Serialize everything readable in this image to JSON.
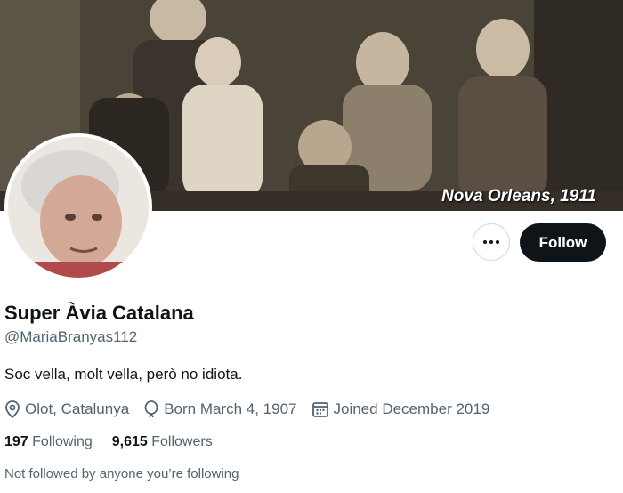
{
  "banner": {
    "caption": "Nova Orleans, 1911"
  },
  "profile": {
    "display_name": "Super Àvia Catalana",
    "handle": "@MariaBranyas112",
    "bio": "Soc vella, molt vella, però no idiota.",
    "location": "Olot, Catalunya",
    "birth": "Born March 4, 1907",
    "joined": "Joined December 2019"
  },
  "actions": {
    "more_icon": "more-horizontal-icon",
    "follow_label": "Follow"
  },
  "stats": {
    "following_count": "197",
    "following_label": "Following",
    "followers_count": "9,615",
    "followers_label": "Followers"
  },
  "social_context": "Not followed by anyone you’re following",
  "colors": {
    "text_primary": "#0f1419",
    "text_secondary": "#536471",
    "button_dark": "#0f1419",
    "border": "#cfd9de"
  }
}
